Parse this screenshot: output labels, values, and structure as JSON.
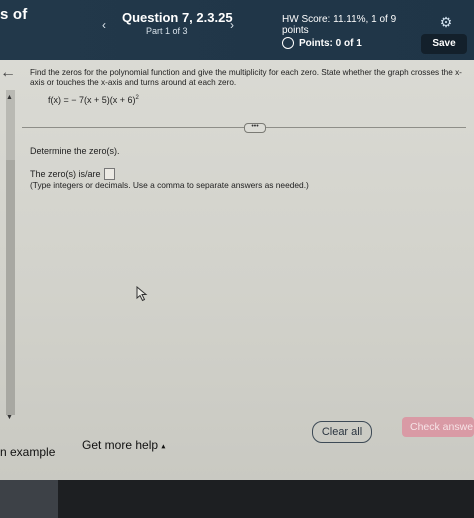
{
  "header": {
    "left_fragment": "s of",
    "prev_arrow": "‹",
    "next_arrow": "›",
    "question_title": "Question 7, 2.3.25",
    "part_label": "Part 1 of 3",
    "hw_score_line": "HW Score: 11.11%, 1 of 9",
    "hw_points_word": "points",
    "points_label": "Points: 0 of 1",
    "save_label": "Save",
    "gear_icon": "⚙"
  },
  "problem": {
    "instructions": "Find the zeros for the polynomial function and give the multiplicity for each zero. State whether the graph crosses the x-axis or touches the x-axis and turns around at each zero.",
    "equation": "f(x) = − 7(x + 5)(x + 6)",
    "equation_exponent": "2",
    "more_label": "•••"
  },
  "answer": {
    "determine_label": "Determine the zero(s).",
    "zeros_label": "The zero(s) is/are",
    "hint": "(Type integers or decimals. Use a comma to separate answers as needed.)"
  },
  "footer": {
    "example_label": "n example",
    "help_label": "Get more help",
    "help_caret": "▴",
    "clear_label": "Clear all",
    "check_label": "Check answe"
  },
  "colors": {
    "header_bg": "#22384a",
    "check_button": "#d99aa5",
    "save_button": "#13202b"
  }
}
